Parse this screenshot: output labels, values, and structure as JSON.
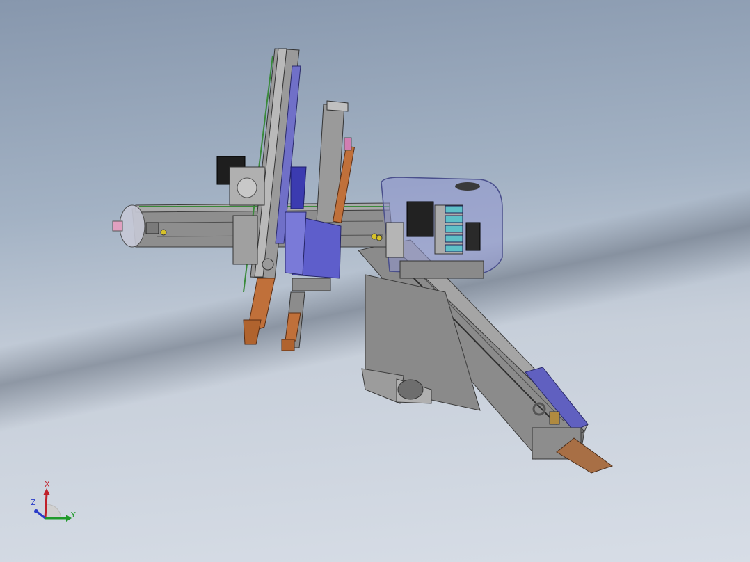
{
  "viewport": {
    "background_top": "#8797ad",
    "background_bottom": "#d7dde6"
  },
  "triad": {
    "x_label": "X",
    "y_label": "Y",
    "z_label": "Z",
    "x_color": "#c0202a",
    "y_color": "#1f9a2a",
    "z_color": "#2a3cc8"
  },
  "colors": {
    "frame": "#8e8e8e",
    "frame_dark": "#5e5e5e",
    "cabinet": "#6d6dd0",
    "cylinder": "#c0703a",
    "base_plate": "#a86f45",
    "rail_green": "#3a8a3a"
  }
}
